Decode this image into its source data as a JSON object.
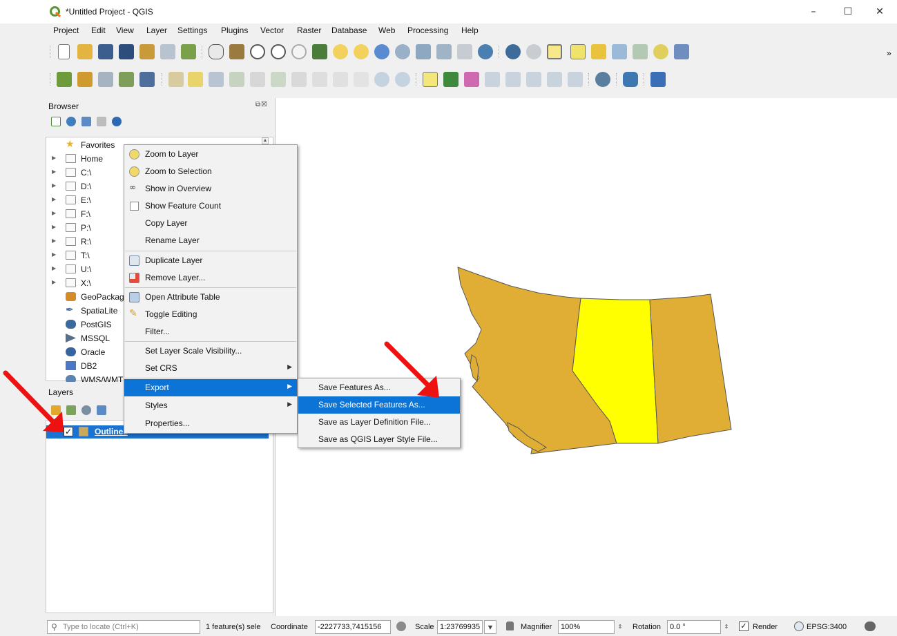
{
  "window": {
    "title": "*Untitled Project - QGIS",
    "minimize": "–",
    "maximize": "☐",
    "close": "✕"
  },
  "menubar": [
    "Project",
    "Edit",
    "View",
    "Layer",
    "Settings",
    "Plugins",
    "Vector",
    "Raster",
    "Database",
    "Web",
    "Processing",
    "Help"
  ],
  "toolbar": {
    "overflow": "»"
  },
  "browser": {
    "title": "Browser",
    "items": [
      {
        "label": "Favorites",
        "icon": "star-icon",
        "arrow": false
      },
      {
        "label": "Home",
        "icon": "home-icon",
        "arrow": true
      },
      {
        "label": "C:\\",
        "icon": "folder-icon",
        "arrow": true
      },
      {
        "label": "D:\\",
        "icon": "folder-icon",
        "arrow": true
      },
      {
        "label": "E:\\",
        "icon": "folder-icon",
        "arrow": true
      },
      {
        "label": "F:\\",
        "icon": "folder-icon",
        "arrow": true
      },
      {
        "label": "P:\\",
        "icon": "folder-icon",
        "arrow": true
      },
      {
        "label": "R:\\",
        "icon": "folder-icon",
        "arrow": true
      },
      {
        "label": "T:\\",
        "icon": "folder-icon",
        "arrow": true
      },
      {
        "label": "U:\\",
        "icon": "folder-icon",
        "arrow": true
      },
      {
        "label": "X:\\",
        "icon": "folder-icon",
        "arrow": true
      },
      {
        "label": "GeoPackage",
        "icon": "geopackage-icon",
        "arrow": false
      },
      {
        "label": "SpatiaLite",
        "icon": "spatialite-icon",
        "arrow": false
      },
      {
        "label": "PostGIS",
        "icon": "postgis-icon",
        "arrow": false
      },
      {
        "label": "MSSQL",
        "icon": "mssql-icon",
        "arrow": false
      },
      {
        "label": "Oracle",
        "icon": "oracle-icon",
        "arrow": false
      },
      {
        "label": "DB2",
        "icon": "db2-icon",
        "arrow": false
      },
      {
        "label": "WMS/WMTS",
        "icon": "wms-icon",
        "arrow": false
      }
    ]
  },
  "layers": {
    "title": "Layers",
    "layer_name": "Outlines",
    "checked": "✓"
  },
  "context_menu": {
    "items": [
      {
        "label": "Zoom to Layer",
        "icon": "zoom-layer-icon"
      },
      {
        "label": "Zoom to Selection",
        "icon": "zoom-selection-icon"
      },
      {
        "label": "Show in Overview",
        "icon": "overview-icon"
      },
      {
        "label": "Show Feature Count",
        "icon": "checkbox"
      },
      {
        "label": "Copy Layer",
        "icon": ""
      },
      {
        "label": "Rename Layer",
        "icon": ""
      },
      {
        "label": "Duplicate Layer",
        "icon": "duplicate-icon"
      },
      {
        "label": "Remove Layer...",
        "icon": "remove-layer-icon"
      },
      {
        "label": "Open Attribute Table",
        "icon": "attribute-table-icon"
      },
      {
        "label": "Toggle Editing",
        "icon": "pencil-icon"
      },
      {
        "label": "Filter...",
        "icon": ""
      },
      {
        "label": "Set Layer Scale Visibility...",
        "icon": ""
      },
      {
        "label": "Set CRS",
        "icon": ""
      },
      {
        "label": "Export",
        "icon": ""
      },
      {
        "label": "Styles",
        "icon": ""
      },
      {
        "label": "Properties...",
        "icon": ""
      }
    ],
    "submenu_arrow": "▶"
  },
  "export_submenu": {
    "items": [
      "Save Features As...",
      "Save Selected Features As...",
      "Save as Layer Definition File...",
      "Save as QGIS Layer Style File..."
    ]
  },
  "statusbar": {
    "locator_placeholder": "Type to locate (Ctrl+K)",
    "selection_text": "1 feature(s) sele",
    "coordinate_label": "Coordinate",
    "coordinate_value": "-2227733,7415156",
    "scale_label": "Scale",
    "scale_value": "1:23769935",
    "magnifier_label": "Magnifier",
    "magnifier_value": "100%",
    "rotation_label": "Rotation",
    "rotation_value": "0.0 °",
    "render_label": "Render",
    "render_checked": "✓",
    "crs": "EPSG:3400"
  },
  "colors": {
    "highlight": "#0c74d6",
    "province_fill": "#e0ae35",
    "selected_fill": "#ffff00",
    "arrow": "#ee1111"
  }
}
